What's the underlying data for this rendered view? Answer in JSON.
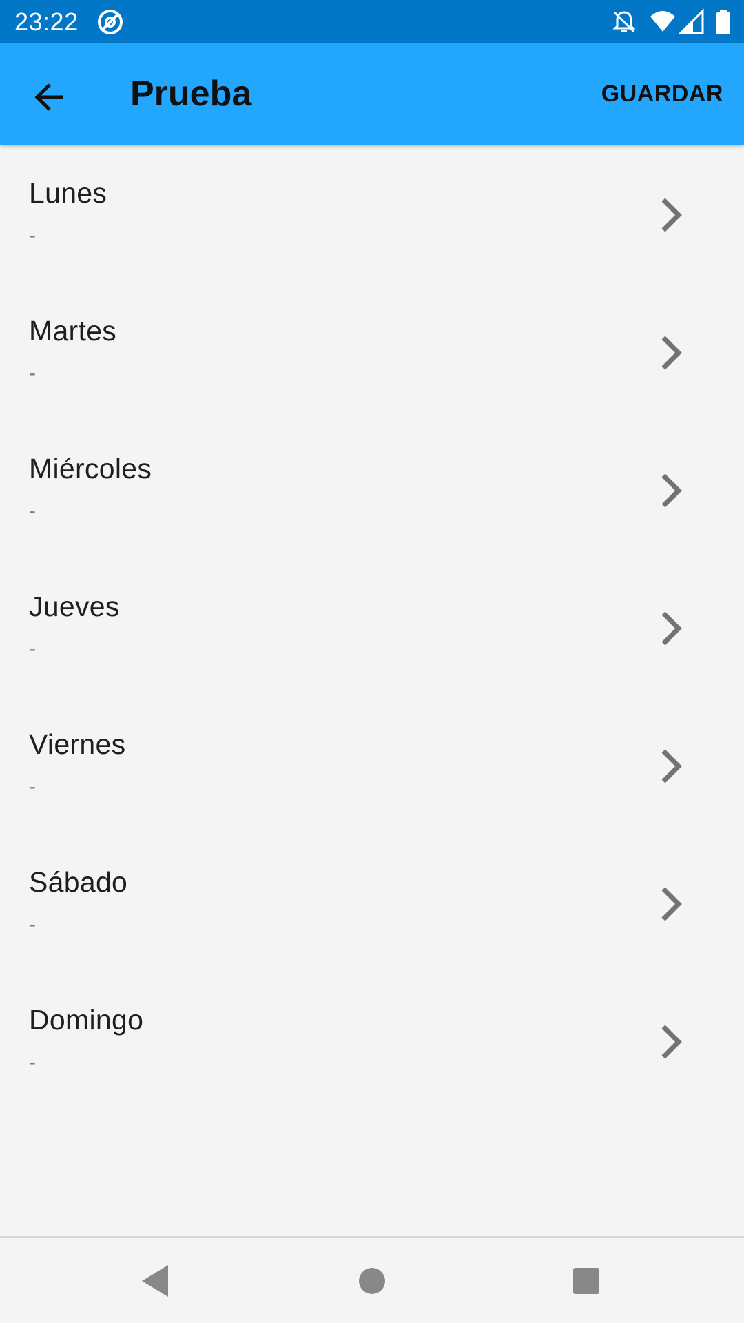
{
  "status_bar": {
    "time": "23:22",
    "icons": [
      "at-sign-icon",
      "notifications-off-icon",
      "wifi-icon",
      "cell-signal-icon",
      "battery-icon"
    ]
  },
  "app_bar": {
    "back_icon": "arrow-back-icon",
    "title": "Prueba",
    "save_label": "GUARDAR",
    "color": "#23a6fe"
  },
  "days": [
    {
      "name": "Lunes",
      "value": "-"
    },
    {
      "name": "Martes",
      "value": "-"
    },
    {
      "name": "Miércoles",
      "value": "-"
    },
    {
      "name": "Jueves",
      "value": "-"
    },
    {
      "name": "Viernes",
      "value": "-"
    },
    {
      "name": "Sábado",
      "value": "-"
    },
    {
      "name": "Domingo",
      "value": "-"
    }
  ],
  "navigation_bar": {
    "buttons": [
      "back-triangle-icon",
      "home-circle-icon",
      "recents-square-icon"
    ]
  },
  "colors": {
    "status_bar": "#0277c8",
    "app_bar": "#23a6fe",
    "background": "#f4f4f4",
    "chevron": "#737373"
  }
}
